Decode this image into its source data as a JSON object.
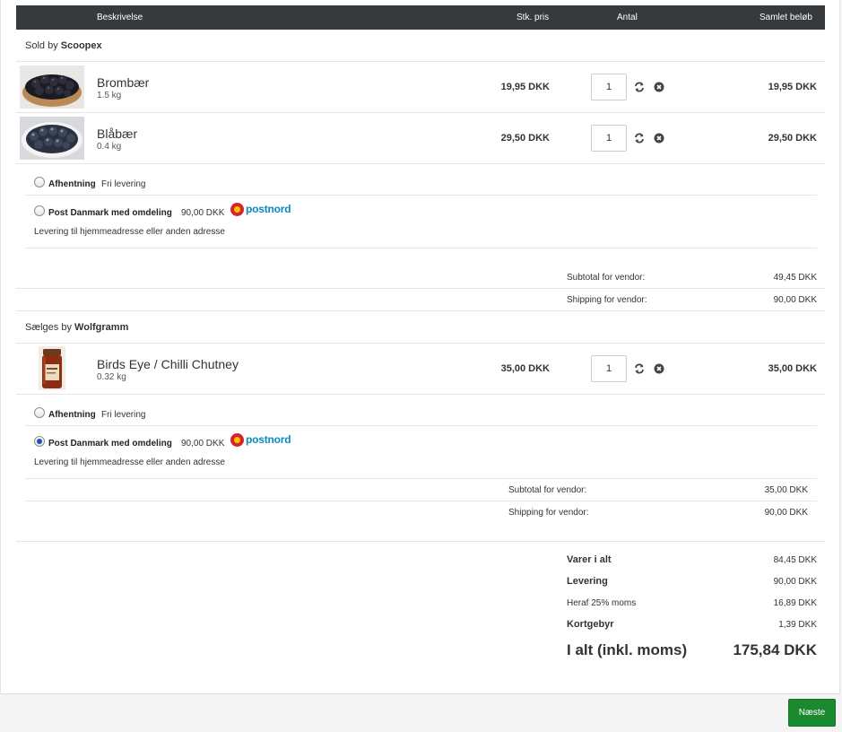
{
  "header": {
    "description": "Beskrivelse",
    "unit_price": "Stk. pris",
    "quantity": "Antal",
    "total": "Samlet beløb"
  },
  "vendors": [
    {
      "label_prefix": "Sold by",
      "name": "Scoopex",
      "products": [
        {
          "name": "Brombær",
          "weight": "1.5 kg",
          "unit_price": "19,95 DKK",
          "qty": "1",
          "total": "19,95 DKK",
          "image": "blackberries"
        },
        {
          "name": "Blåbær",
          "weight": "0.4 kg",
          "unit_price": "29,50 DKK",
          "qty": "1",
          "total": "29,50 DKK",
          "image": "blueberries"
        }
      ],
      "shipping": [
        {
          "label": "Afhentning",
          "value": "Fri levering",
          "selected": false
        },
        {
          "label": "Post Danmark med omdeling",
          "value": "90,00 DKK",
          "logo_text": "postnord",
          "note": "Levering til hjemmeadresse eller anden adresse",
          "selected": false
        }
      ],
      "subtotal_label": "Subtotal for vendor:",
      "subtotal_value": "49,45 DKK",
      "shipping_label": "Shipping for vendor:",
      "shipping_value": "90,00 DKK"
    },
    {
      "label_prefix": "Sælges by",
      "name": "Wolfgramm",
      "products": [
        {
          "name": "Birds Eye / Chilli Chutney",
          "weight": "0.32 kg",
          "unit_price": "35,00 DKK",
          "qty": "1",
          "total": "35,00 DKK",
          "image": "chutney-jar"
        }
      ],
      "shipping": [
        {
          "label": "Afhentning",
          "value": "Fri levering",
          "selected": false
        },
        {
          "label": "Post Danmark med omdeling",
          "value": "90,00 DKK",
          "logo_text": "postnord",
          "note": "Levering til hjemmeadresse eller anden adresse",
          "selected": true
        }
      ],
      "subtotal_label": "Subtotal for vendor:",
      "subtotal_value": "35,00 DKK",
      "shipping_label": "Shipping for vendor:",
      "shipping_value": "90,00 DKK"
    }
  ],
  "totals": {
    "items_label": "Varer i alt",
    "items_value": "84,45 DKK",
    "delivery_label": "Levering",
    "delivery_value": "90,00 DKK",
    "vat_label": "Heraf 25% moms",
    "vat_value": "16,89 DKK",
    "card_fee_label": "Kortgebyr",
    "card_fee_value": "1,39 DKK",
    "grand_label": "I alt (inkl. moms)",
    "grand_value": "175,84 DKK"
  },
  "next_button": "Næste",
  "icons": {
    "refresh": "refresh-icon",
    "remove": "remove-icon"
  },
  "colors": {
    "header_bg": "#373a3c",
    "next_button": "#1b8a2f",
    "postnord_blue": "#0a8bb8"
  }
}
